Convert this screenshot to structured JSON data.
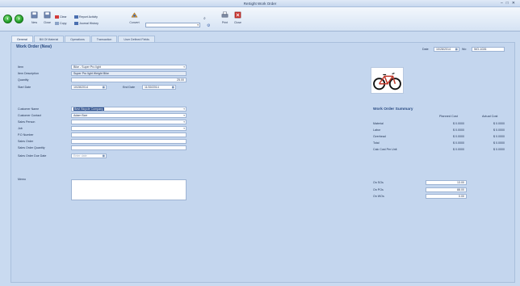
{
  "window": {
    "title": "ReSight Work Order",
    "controls": [
      "–",
      "□",
      "✕"
    ]
  },
  "ribbon": {
    "new_label": "New",
    "close_label": "Close",
    "clear_label": "Clear",
    "copy_label": "Copy",
    "report_activity_label": "Report Activity",
    "journal_history_label": "Journal History",
    "convert_label": "Convert",
    "print_label": "Print",
    "close2_label": "Close"
  },
  "tabs": [
    "General",
    "Bill Of Material",
    "Operations",
    "Transaction",
    "User Defined Fields"
  ],
  "page_title": "Work Order (New)",
  "header_fields": {
    "date_label": "Date",
    "date_value": "10/28/2014",
    "no_label": "Wo",
    "no_value": "WO-1026"
  },
  "form": {
    "item_label": "Item",
    "item_value": "Bike - Super Pro light",
    "item_desc_label": "Item Description",
    "item_desc_value": "Super Pro light Weight Bike",
    "quantity_label": "Quantity",
    "quantity_value": "25.00",
    "start_date_label": "Start Date",
    "start_date_value": "10/28/2014",
    "end_date_label": "End Date",
    "end_date_value": "11/30/2014",
    "customer_name_label": "Customer Name",
    "customer_name_value": "Best Bicycle Company",
    "customer_contact_label": "Customer Contact",
    "customer_contact_value": "Adam Barr",
    "sales_person_label": "Sales Person",
    "job_label": "Job",
    "po_label": "P.O Number",
    "sales_order_label": "Sales Order",
    "sales_order_qty_label": "Sales Order Quantity",
    "sales_order_due_label": "Sales Order Due Date",
    "sales_order_due_placeholder": "Enter date",
    "memo_label": "Memo"
  },
  "summary": {
    "title": "Work Order Summary",
    "planned_header": "Planned Cost",
    "actual_header": "Actual Cost",
    "rows": [
      {
        "label": "Material",
        "planned": "$ 0.0000",
        "actual": "$ 0.0000"
      },
      {
        "label": "Labor",
        "planned": "$ 0.0000",
        "actual": "$ 0.0000"
      },
      {
        "label": "Overhead",
        "planned": "$ 0.0000",
        "actual": "$ 0.0000"
      },
      {
        "label": "Total",
        "planned": "$ 0.0000",
        "actual": "$ 0.0000"
      },
      {
        "label": "Calc Cost Per Unit",
        "planned": "$ 0.0000",
        "actual": "$ 0.0000"
      }
    ]
  },
  "stock": {
    "on_so_label": "On SOs",
    "on_so_value": "13.00",
    "on_po_label": "On POs",
    "on_po_value": "88.00",
    "on_wo_label": "On WOs",
    "on_wo_value": "0.00"
  },
  "colors": {
    "accent": "#2a4b82",
    "panel": "#c4d6ee",
    "highlight": "#2d4f8c"
  }
}
